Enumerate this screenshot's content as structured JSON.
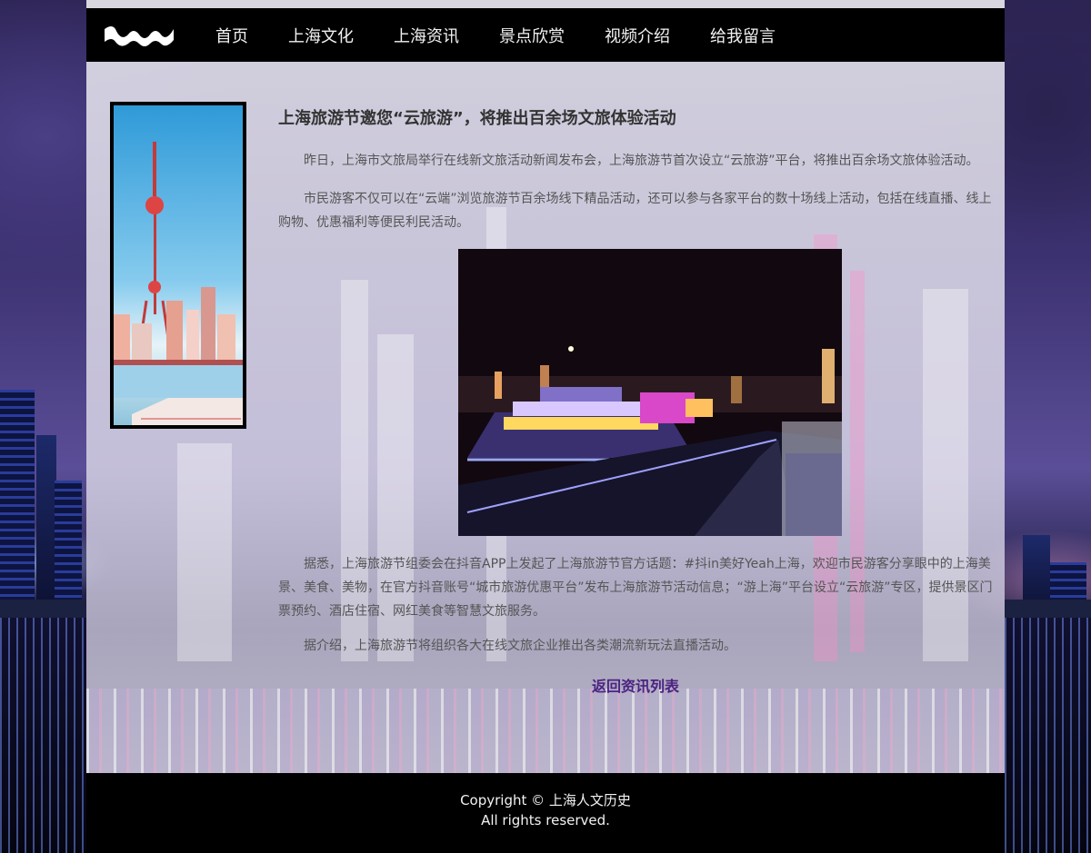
{
  "nav": {
    "logo_icon": "wave-logo-icon",
    "items": [
      {
        "label": "首页"
      },
      {
        "label": "上海文化"
      },
      {
        "label": "上海资讯"
      },
      {
        "label": "景点欣赏"
      },
      {
        "label": "视频介绍"
      },
      {
        "label": "给我留言"
      }
    ]
  },
  "article": {
    "title": "上海旅游节邀您“云旅游”，将推出百余场文旅体验活动",
    "paragraphs": [
      "昨日，上海市文旅局举行在线新文旅活动新闻发布会，上海旅游节首次设立“云旅游”平台，将推出百余场文旅体验活动。",
      "市民游客不仅可以在“云端”浏览旅游节百余场线下精品活动，还可以参与各家平台的数十场线上活动，包括在线直播、线上购物、优惠福利等便民利民活动。",
      "据悉，上海旅游节组委会在抖音APP上发起了上海旅游节官方话题：#抖in美好Yeah上海，欢迎市民游客分享眼中的上海美景、美食、美物，在官方抖音账号“城市旅游优惠平台”发布上海旅游节活动信息；“游上海”平台设立“云旅游”专区，提供景区门票预约、酒店住宿、网红美食等智慧文旅服务。",
      "据介绍，上海旅游节将组织各大在线文旅企业推出各类潮流新玩法直播活动。"
    ],
    "back_link": "返回资讯列表"
  },
  "footer": {
    "line1": "Copyright © 上海人文历史",
    "line2": "All rights reserved."
  },
  "colors": {
    "nav_bg": "#000000",
    "link": "#4b2382",
    "text": "#555555"
  }
}
